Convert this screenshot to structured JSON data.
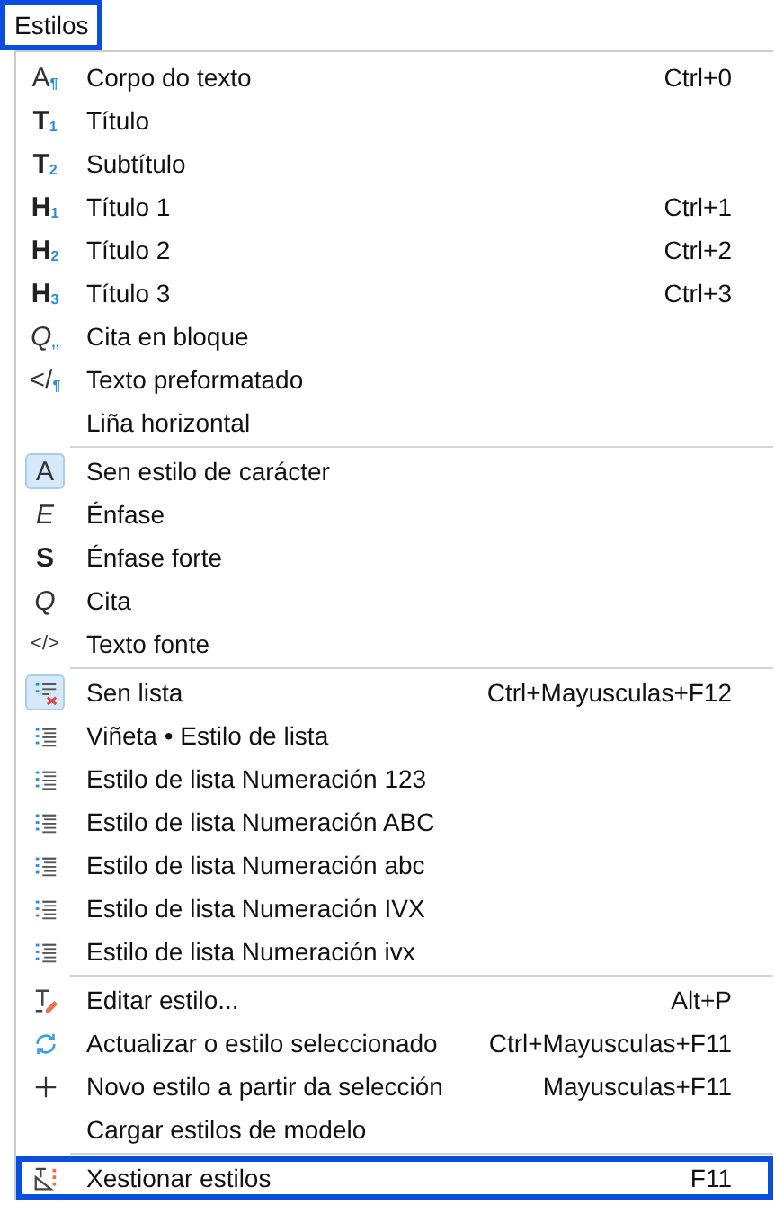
{
  "menu_title": {
    "label": "Estilos",
    "highlighted": true
  },
  "sections": [
    {
      "items": [
        {
          "label": "Corpo do texto",
          "shortcut": "Ctrl+0",
          "icon": {
            "kind": "plain",
            "glyph": "A",
            "sub": "¶"
          }
        },
        {
          "label": "Título",
          "icon": {
            "kind": "bold",
            "glyph": "T",
            "sub": "1"
          }
        },
        {
          "label": "Subtítulo",
          "icon": {
            "kind": "bold",
            "glyph": "T",
            "sub": "2"
          }
        },
        {
          "label": "Título 1",
          "shortcut": "Ctrl+1",
          "icon": {
            "kind": "bold",
            "glyph": "H",
            "sub": "1"
          }
        },
        {
          "label": "Título 2",
          "shortcut": "Ctrl+2",
          "icon": {
            "kind": "bold",
            "glyph": "H",
            "sub": "2"
          }
        },
        {
          "label": "Título 3",
          "shortcut": "Ctrl+3",
          "icon": {
            "kind": "bold",
            "glyph": "H",
            "sub": "3"
          }
        },
        {
          "label": "Cita en bloque",
          "icon": {
            "kind": "italic",
            "glyph": "Q",
            "sub": ",,"
          }
        },
        {
          "label": "Texto preformatado",
          "icon": {
            "kind": "plain",
            "glyph": "</",
            "sub": "¶"
          }
        },
        {
          "label": "Liña horizontal",
          "icon": {
            "kind": "none"
          }
        }
      ]
    },
    {
      "items": [
        {
          "label": "Sen estilo de carácter",
          "checked": true,
          "icon": {
            "kind": "plain",
            "glyph": "A"
          }
        },
        {
          "label": "Énfase",
          "checked": false,
          "icon": {
            "kind": "italic",
            "glyph": "E"
          }
        },
        {
          "label": "Énfase forte",
          "checked": false,
          "icon": {
            "kind": "bold",
            "glyph": "S"
          }
        },
        {
          "label": "Cita",
          "checked": false,
          "icon": {
            "kind": "italic",
            "glyph": "Q"
          }
        },
        {
          "label": "Texto fonte",
          "checked": false,
          "icon": {
            "kind": "code",
            "glyph": "</>"
          }
        }
      ]
    },
    {
      "items": [
        {
          "label": "Sen lista",
          "shortcut": "Ctrl+Mayusculas+F12",
          "checked": true,
          "icon": {
            "kind": "nolist"
          }
        },
        {
          "label": "Viñeta • Estilo de lista",
          "checked": false,
          "icon": {
            "kind": "list"
          }
        },
        {
          "label": "Estilo de lista Numeración 123",
          "checked": false,
          "icon": {
            "kind": "list"
          }
        },
        {
          "label": "Estilo de lista Numeración ABC",
          "checked": false,
          "icon": {
            "kind": "list"
          }
        },
        {
          "label": "Estilo de lista Numeración abc",
          "checked": false,
          "icon": {
            "kind": "list"
          }
        },
        {
          "label": "Estilo de lista Numeración IVX",
          "checked": false,
          "icon": {
            "kind": "list"
          }
        },
        {
          "label": "Estilo de lista Numeración ivx",
          "checked": false,
          "icon": {
            "kind": "list"
          }
        }
      ]
    },
    {
      "items": [
        {
          "label": "Editar estilo...",
          "shortcut": "Alt+P",
          "icon": {
            "kind": "edit"
          }
        },
        {
          "label": "Actualizar o estilo seleccionado",
          "shortcut": "Ctrl+Mayusculas+F11",
          "icon": {
            "kind": "refresh"
          }
        },
        {
          "label": "Novo estilo a partir da selección",
          "shortcut": "Mayusculas+F11",
          "icon": {
            "kind": "plus"
          }
        },
        {
          "label": "Cargar estilos de modelo",
          "icon": {
            "kind": "none"
          }
        }
      ]
    },
    {
      "items": [
        {
          "label": "Xestionar estilos",
          "shortcut": "F11",
          "highlighted": true,
          "icon": {
            "kind": "manage"
          }
        }
      ]
    }
  ]
}
